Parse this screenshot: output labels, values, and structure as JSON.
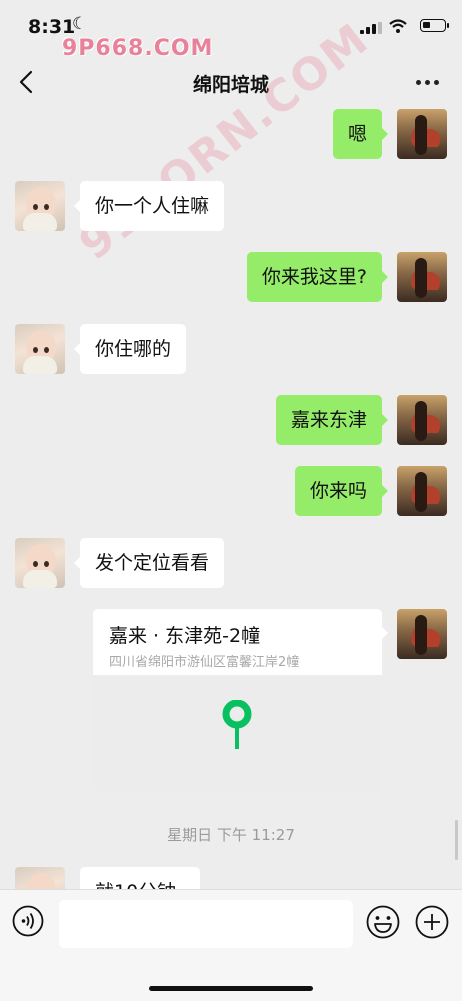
{
  "status_bar": {
    "time": "8:31",
    "battery_level": 0.25
  },
  "watermarks": {
    "top": "9P668.COM",
    "diagonal": "91PORN.COM"
  },
  "nav": {
    "title": "绵阳培城"
  },
  "messages": [
    {
      "sender": "self",
      "text": "嗯"
    },
    {
      "sender": "other",
      "text": "你一个人住嘛"
    },
    {
      "sender": "self",
      "text": "你来我这里?"
    },
    {
      "sender": "other",
      "text": "你住哪的"
    },
    {
      "sender": "self",
      "text": "嘉来东津"
    },
    {
      "sender": "self",
      "text": "你来吗"
    },
    {
      "sender": "other",
      "text": "发个定位看看"
    }
  ],
  "location": {
    "name": "嘉来 · 东津苑-2幢",
    "address": "四川省绵阳市游仙区富馨江岸2幢"
  },
  "timestamp": "星期日 下午 11:27",
  "partial_message": "就10分钟",
  "colors": {
    "self_bubble": "#95ec69",
    "other_bubble": "#ffffff",
    "background": "#ededed",
    "map_pin": "#07c160"
  }
}
